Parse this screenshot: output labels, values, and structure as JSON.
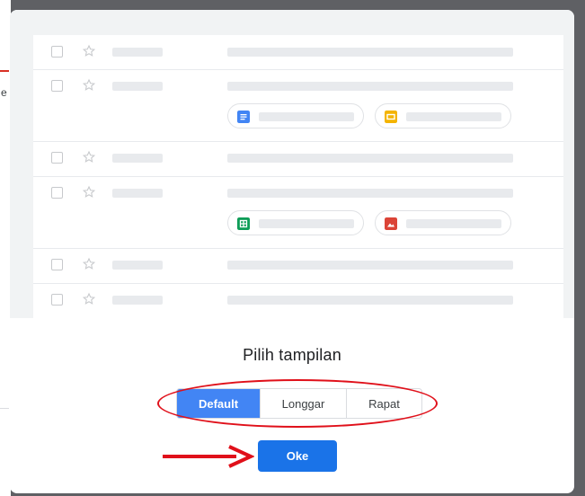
{
  "background": {
    "letter": "e"
  },
  "dialog": {
    "title": "Pilih tampilan",
    "density_options": [
      {
        "label": "Default",
        "selected": true
      },
      {
        "label": "Longgar",
        "selected": false
      },
      {
        "label": "Rapat",
        "selected": false
      }
    ],
    "ok_label": "Oke"
  },
  "preview": {
    "row_count": 6,
    "attachment_icons": [
      "docs-icon",
      "slides-icon",
      "sheets-icon",
      "photo-icon"
    ]
  },
  "colors": {
    "accent": "#1a73e8",
    "selected_segment": "#4285f4",
    "annotation_red": "#e0101a",
    "docs": "#4285f4",
    "slides": "#f4b400",
    "sheets": "#0f9d58",
    "photo": "#db4437"
  },
  "annotations": {
    "oval_around": "density_options",
    "arrow_points_to": "ok_button"
  }
}
